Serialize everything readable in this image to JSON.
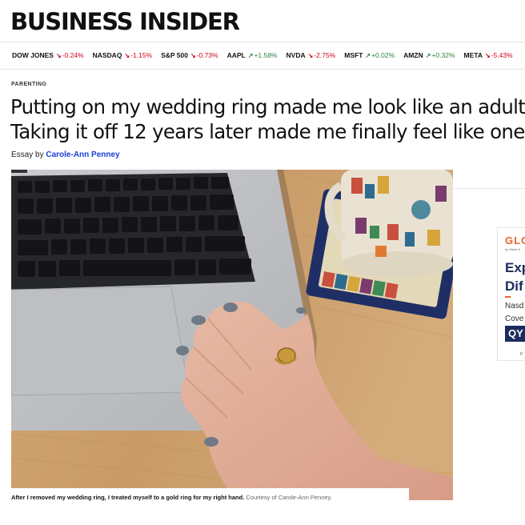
{
  "site": {
    "logo": "BUSINESS INSIDER"
  },
  "ticker": [
    {
      "symbol": "DOW JONES",
      "change": "-0.24%",
      "direction": "down"
    },
    {
      "symbol": "NASDAQ",
      "change": "-1.15%",
      "direction": "down"
    },
    {
      "symbol": "S&P 500",
      "change": "-0.73%",
      "direction": "down"
    },
    {
      "symbol": "AAPL",
      "change": "+1.58%",
      "direction": "up"
    },
    {
      "symbol": "NVDA",
      "change": "-2.75%",
      "direction": "down"
    },
    {
      "symbol": "MSFT",
      "change": "+0.02%",
      "direction": "up"
    },
    {
      "symbol": "AMZN",
      "change": "+0.32%",
      "direction": "up"
    },
    {
      "symbol": "META",
      "change": "-5.43%",
      "direction": "down"
    }
  ],
  "article": {
    "kicker": "PARENTING",
    "headline_line1": "Putting on my wedding ring made me look like an adult.",
    "headline_line2": "Taking it off 12 years later made me finally feel like one.",
    "byline_prefix": "Essay by",
    "author": "Carole-Ann Penney",
    "caption": "After I removed my wedding ring, I treated myself to a gold ring for my right hand.",
    "credit": "Courtesy of Carole-Ann Penney."
  },
  "ad": {
    "brand": "GLO",
    "sub": "by Mirae A",
    "head_line1": "Exp",
    "head_line2": "Dif",
    "body_line1": "Nasd",
    "body_line2": "Cove",
    "badge": "QY",
    "foot": "P"
  },
  "colors": {
    "up": "#2e8540",
    "down": "#d0021b",
    "link": "#1a40d6",
    "ad_brand": "#e8642c",
    "ad_navy": "#1a2c5b"
  }
}
